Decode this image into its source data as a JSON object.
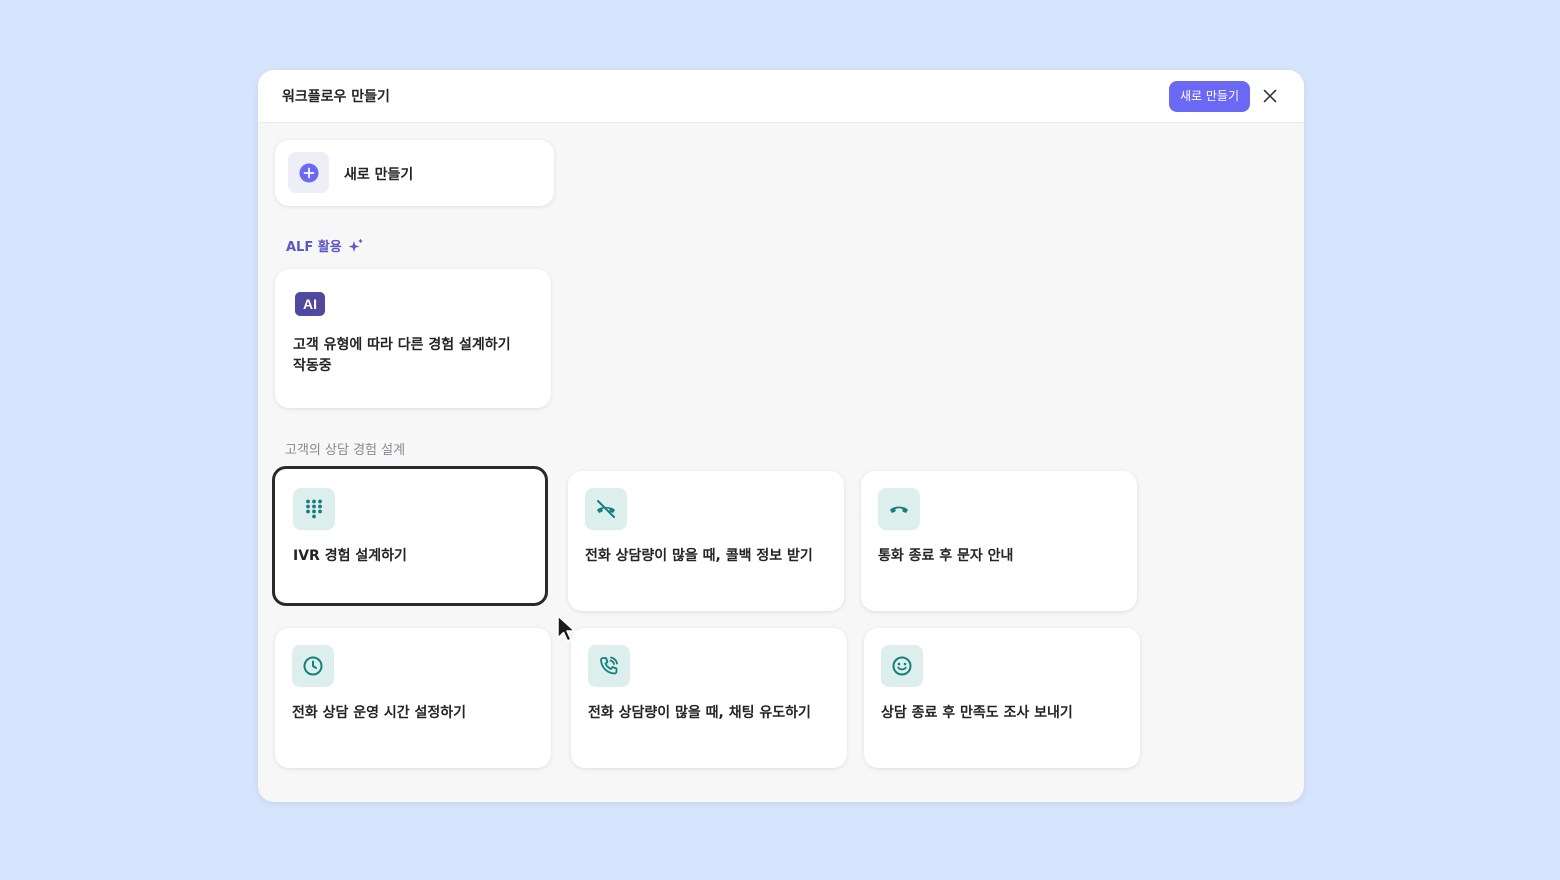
{
  "modal": {
    "title": "워크플로우 만들기",
    "new_button_label": "새로 만들기"
  },
  "new_card": {
    "label": "새로 만들기"
  },
  "alf_section": {
    "label": "ALF 활용",
    "card": {
      "badge": "AI",
      "title": "고객 유형에 따라 다른 경험 설계하기",
      "status": "작동중"
    }
  },
  "design_section": {
    "label": "고객의 상담 경험 설계",
    "cards": [
      {
        "label": "IVR 경험 설계하기",
        "icon": "dialpad-icon",
        "selected": true
      },
      {
        "label": "전화 상담량이 많을 때, 콜백 정보 받기",
        "icon": "phone-missed-icon"
      },
      {
        "label": "통화 종료 후 문자 안내",
        "icon": "hang-up-icon"
      },
      {
        "label": "전화 상담 운영 시간 설정하기",
        "icon": "clock-icon"
      },
      {
        "label": "전화 상담량이 많을 때, 채팅 유도하기",
        "icon": "phone-ringing-icon"
      },
      {
        "label": "상담 종료 후 만족도 조사 보내기",
        "icon": "smiley-icon"
      }
    ]
  },
  "colors": {
    "background": "#d6e4fd",
    "accent": "#6b68f5",
    "icon_teal": "#157f7d",
    "icon_bg": "#dcefed",
    "ai_badge": "#4f4a9f"
  }
}
